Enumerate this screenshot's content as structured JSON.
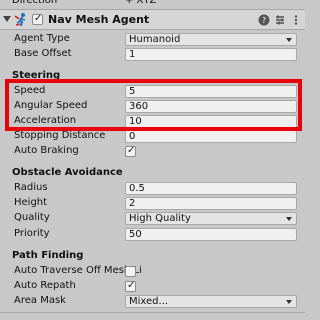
{
  "top_row": {
    "label": "Direction",
    "value": "+ XYZ"
  },
  "component": {
    "title": "Nav Mesh Agent",
    "enabled": true,
    "icons": [
      "help-icon",
      "preset-icon",
      "more-options-icon"
    ]
  },
  "agent": [
    {
      "label": "Agent Type",
      "value": "Humanoid",
      "kind": "dropdown"
    },
    {
      "label": "Base Offset",
      "value": "1",
      "kind": "field"
    }
  ],
  "steering": {
    "title": "Steering",
    "props": [
      {
        "label": "Speed",
        "value": "5",
        "kind": "field"
      },
      {
        "label": "Angular Speed",
        "value": "360",
        "kind": "field"
      },
      {
        "label": "Acceleration",
        "value": "10",
        "kind": "field"
      },
      {
        "label": "Stopping Distance",
        "value": "0",
        "kind": "field"
      },
      {
        "label": "Auto Braking",
        "value": true,
        "kind": "checkbox"
      }
    ]
  },
  "obstacle": {
    "title": "Obstacle Avoidance",
    "props": [
      {
        "label": "Radius",
        "value": "0.5",
        "kind": "field"
      },
      {
        "label": "Height",
        "value": "2",
        "kind": "field"
      },
      {
        "label": "Quality",
        "value": "High Quality",
        "kind": "dropdown"
      },
      {
        "label": "Priority",
        "value": "50",
        "kind": "field"
      }
    ]
  },
  "pathfinding": {
    "title": "Path Finding",
    "props": [
      {
        "label": "Auto Traverse Off Mesh Li",
        "value": false,
        "kind": "checkbox"
      },
      {
        "label": "Auto Repath",
        "value": true,
        "kind": "checkbox"
      },
      {
        "label": "Area Mask",
        "value": "Mixed...",
        "kind": "dropdown"
      }
    ]
  },
  "colors": {
    "highlight": "#e8000b",
    "panel": "#c8c8c8",
    "header": "#d5d5d5"
  },
  "checkmark": "✓"
}
